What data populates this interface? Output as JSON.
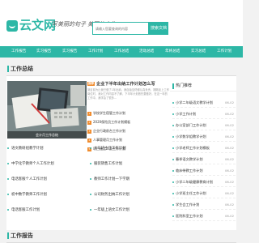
{
  "brand": {
    "name": "云文网",
    "slogan": "写美丽的句子 美丽的人生",
    "accent": "#2db7a6",
    "tag_color": "#f08c2e"
  },
  "search": {
    "placeholder": "请输入您要查询的内容",
    "button_label": "搜索文档"
  },
  "nav": [
    "工作报告",
    "实习报告",
    "实习报告",
    "工作计划",
    "工作总结",
    "活动总结",
    "年终总结",
    "实习总结",
    "工作计划"
  ],
  "section1": {
    "title": "工作总结"
  },
  "photo_caption": "会计月工作总结",
  "featured": {
    "tag": "推荐",
    "title": "企业下半年出纳工作计划怎么写",
    "desc": "到目前为止我已做了1年出纳，我自始至终都认真负责，刚刚走上工作岗位时，我对工作内容不了解，下半年计划首先要做好，在这一年的工作中，我学会了很多..."
  },
  "middle_list": [
    "学校学生宿管工作计划",
    "2020保险员工作计划模板",
    "企业行政前台工作计划",
    "人事管理月工作计划",
    "项目施工人员工作计划"
  ],
  "left_list": [
    "语文教研组教学计划",
    "中学化学教师个人工作计划",
    "电话客服个人工作计划",
    "初中数学教师工作计划",
    "电话客服工作计划"
  ],
  "right_inner_list": [
    "大三班主任工作计划",
    "服装销售工作计划",
    "教师工作计划一下学期",
    "公司财务出纳工作计划",
    "一年级上语文工作计划"
  ],
  "sidebar": {
    "title": "热门推荐",
    "items": [
      {
        "title": "小学二年级语文教学计划",
        "date": "06-02"
      },
      {
        "title": "小学工作计划",
        "date": "06-02"
      },
      {
        "title": "办公室部门工作计划",
        "date": "06-02"
      },
      {
        "title": "小学数学组教学计划",
        "date": "06-02"
      },
      {
        "title": "小学老师工作计划模板",
        "date": "06-02"
      },
      {
        "title": "春季语文教学计划",
        "date": "06-02"
      },
      {
        "title": "临床带教工作计划",
        "date": "06-02"
      },
      {
        "title": "小学二年级健康教育计划",
        "date": "06-02"
      },
      {
        "title": "小学班主任工作计划",
        "date": "06-02"
      },
      {
        "title": "学生会工作计划",
        "date": "06-02"
      },
      {
        "title": "医院科室工作计划",
        "date": "06-02"
      }
    ]
  },
  "section2": {
    "title": "工作报告"
  }
}
